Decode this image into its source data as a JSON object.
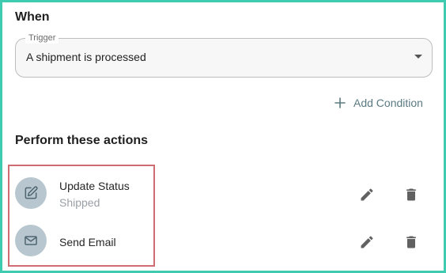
{
  "when": {
    "title": "When",
    "trigger": {
      "label": "Trigger",
      "value": "A shipment is processed",
      "icon": "chevron-down-icon"
    },
    "add_condition": {
      "label": "Add Condition",
      "icon": "plus-icon"
    }
  },
  "actions": {
    "title": "Perform these actions",
    "items": [
      {
        "title": "Update Status",
        "subtitle": "Shipped",
        "icon": "edit-square-icon",
        "edit_icon": "pencil-icon",
        "delete_icon": "trash-icon"
      },
      {
        "title": "Send Email",
        "subtitle": "",
        "icon": "mail-icon",
        "edit_icon": "pencil-icon",
        "delete_icon": "trash-icon"
      }
    ]
  },
  "colors": {
    "frame_border": "#3ecbb0",
    "highlight_border": "#cf6b73",
    "avatar_bg": "#b8c7cf",
    "add_condition": "#5a7a82"
  }
}
